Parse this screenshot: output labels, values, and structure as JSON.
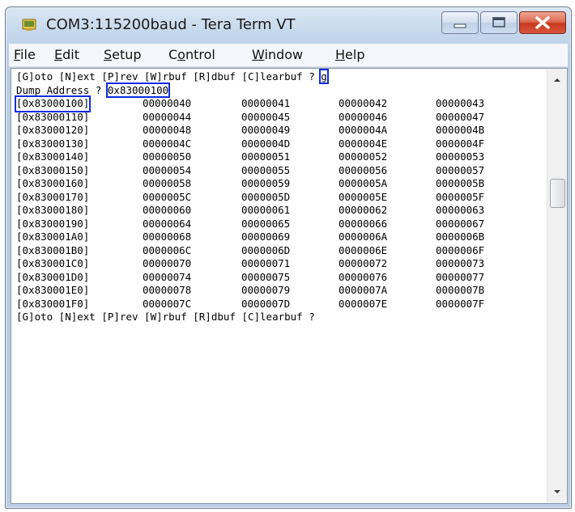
{
  "window": {
    "title": "COM3:115200baud - Tera Term VT",
    "app_icon": "teraterm-icon"
  },
  "caption_buttons": {
    "minimize_icon": "minimize-icon",
    "maximize_icon": "maximize-icon",
    "close_icon": "close-icon"
  },
  "menu": {
    "items": [
      {
        "accel": "F",
        "rest": "ile"
      },
      {
        "accel": "E",
        "rest": "dit"
      },
      {
        "accel": "S",
        "rest": "etup"
      },
      {
        "pre": "C",
        "accel": "o",
        "rest": "ntrol"
      },
      {
        "accel": "W",
        "rest": "indow"
      },
      {
        "accel": "H",
        "rest": "elp"
      }
    ]
  },
  "terminal": {
    "prompt_line": "[G]oto [N]ext [P]rev [W]rbuf [R]dbuf [C]learbuf ? ",
    "prompt_input": "g",
    "dump_label": "Dump Address ? ",
    "dump_value": "0x83000100",
    "rows": [
      {
        "addr": "[0x83000100]",
        "v": [
          "00000040",
          "00000041",
          "00000042",
          "00000043"
        ]
      },
      {
        "addr": "[0x83000110]",
        "v": [
          "00000044",
          "00000045",
          "00000046",
          "00000047"
        ]
      },
      {
        "addr": "[0x83000120]",
        "v": [
          "00000048",
          "00000049",
          "0000004A",
          "0000004B"
        ]
      },
      {
        "addr": "[0x83000130]",
        "v": [
          "0000004C",
          "0000004D",
          "0000004E",
          "0000004F"
        ]
      },
      {
        "addr": "[0x83000140]",
        "v": [
          "00000050",
          "00000051",
          "00000052",
          "00000053"
        ]
      },
      {
        "addr": "[0x83000150]",
        "v": [
          "00000054",
          "00000055",
          "00000056",
          "00000057"
        ]
      },
      {
        "addr": "[0x83000160]",
        "v": [
          "00000058",
          "00000059",
          "0000005A",
          "0000005B"
        ]
      },
      {
        "addr": "[0x83000170]",
        "v": [
          "0000005C",
          "0000005D",
          "0000005E",
          "0000005F"
        ]
      },
      {
        "addr": "[0x83000180]",
        "v": [
          "00000060",
          "00000061",
          "00000062",
          "00000063"
        ]
      },
      {
        "addr": "[0x83000190]",
        "v": [
          "00000064",
          "00000065",
          "00000066",
          "00000067"
        ]
      },
      {
        "addr": "[0x830001A0]",
        "v": [
          "00000068",
          "00000069",
          "0000006A",
          "0000006B"
        ]
      },
      {
        "addr": "[0x830001B0]",
        "v": [
          "0000006C",
          "0000006D",
          "0000006E",
          "0000006F"
        ]
      },
      {
        "addr": "[0x830001C0]",
        "v": [
          "00000070",
          "00000071",
          "00000072",
          "00000073"
        ]
      },
      {
        "addr": "[0x830001D0]",
        "v": [
          "00000074",
          "00000075",
          "00000076",
          "00000077"
        ]
      },
      {
        "addr": "[0x830001E0]",
        "v": [
          "00000078",
          "00000079",
          "0000007A",
          "0000007B"
        ]
      },
      {
        "addr": "[0x830001F0]",
        "v": [
          "0000007C",
          "0000007D",
          "0000007E",
          "0000007F"
        ]
      }
    ],
    "final_prompt": "[G]oto [N]ext [P]rev [W]rbuf [R]dbuf [C]learbuf ?"
  },
  "scrollbar": {
    "up_icon": "scroll-up-arrow-icon",
    "down_icon": "scroll-down-arrow-icon"
  },
  "colors": {
    "highlight_box": "#0c2be0",
    "close_button": "#c7391e"
  }
}
